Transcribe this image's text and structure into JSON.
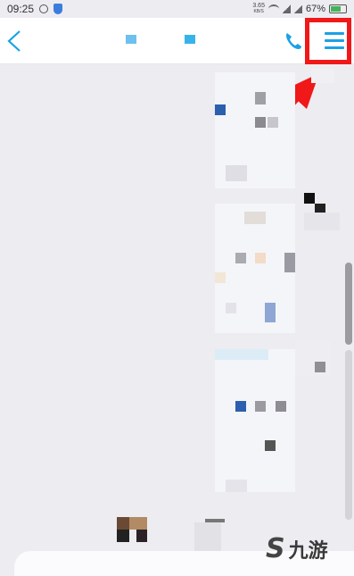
{
  "status_bar": {
    "time": "09:25",
    "net_speed_value": "3.65",
    "net_speed_unit": "KB/S",
    "battery": "67%",
    "battery_level": 0.67
  },
  "header": {
    "back_icon": "chevron-left-icon",
    "call_icon": "phone-icon",
    "menu_icon": "hamburger-menu-icon"
  },
  "annotation": {
    "highlight_color": "#f01818",
    "target": "menu-button"
  },
  "colors": {
    "accent": "#1aa2e6",
    "background": "#ececf1",
    "header_bg": "#ffffff"
  },
  "watermark": {
    "logo_glyph": "S",
    "text": "九游"
  }
}
